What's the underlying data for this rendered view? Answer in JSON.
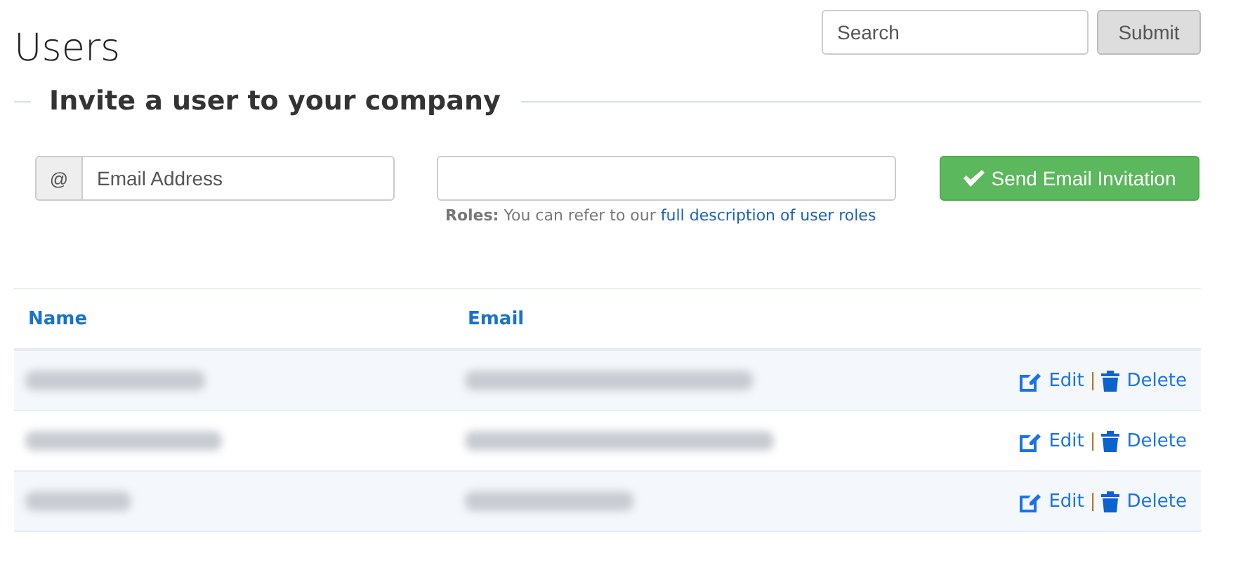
{
  "page_title": "Users",
  "search": {
    "placeholder": "Search",
    "button": "Submit"
  },
  "invite": {
    "heading": "Invite a user to your company",
    "email_addon": "@",
    "email_placeholder": "Email Address",
    "send_button": "Send Email Invitation",
    "help_label": "Roles:",
    "help_text": "You can refer to our",
    "help_link": "full description of user roles"
  },
  "table": {
    "columns": [
      "Name",
      "Email"
    ],
    "rows": [
      {
        "name": {
          "kind": "blurred"
        },
        "email": {
          "kind": "blurred"
        },
        "edit": "Edit",
        "separator": "|",
        "delete": "Delete"
      },
      {
        "name": {
          "kind": "blurred"
        },
        "email": {
          "kind": "blurred"
        },
        "edit": "Edit",
        "separator": "|",
        "delete": "Delete"
      },
      {
        "name": {
          "kind": "blurred"
        },
        "email": {
          "kind": "blurred"
        },
        "edit": "Edit",
        "separator": "|",
        "delete": "Delete"
      }
    ]
  }
}
